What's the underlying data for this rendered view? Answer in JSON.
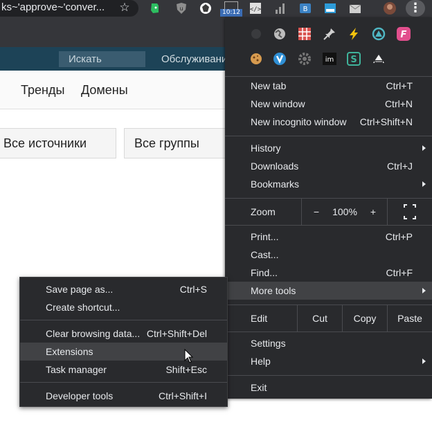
{
  "toolbar": {
    "omnibox_text": "ks~'approve~'conver...",
    "clock_text": "10:12",
    "extension_icons": [
      "evernote-icon",
      "ublock-icon",
      "vpn-icon",
      "clock-icon",
      "dev-icon",
      "chart-icon",
      "translate-icon",
      "screenshot-icon",
      "mail-icon",
      "avatar-icon"
    ],
    "menu_button": "kebab-menu-icon"
  },
  "page": {
    "search_label": "Искать",
    "service_label": "Обслуживани",
    "nav_items": [
      "Тренды",
      "Домены"
    ],
    "filters": [
      "Все источники",
      "Все группы"
    ]
  },
  "menu": {
    "extension_rows": [
      [
        "hidden-icon",
        "globe-icon",
        "grid-icon",
        "pin-icon",
        "bolt-icon",
        "triangle-icon",
        "f-icon"
      ],
      [
        "cookie-icon",
        "v-icon",
        "gear-icon",
        "im-icon",
        "s-icon",
        "camera-icon"
      ]
    ],
    "new_tab": {
      "label": "New tab",
      "shortcut": "Ctrl+T"
    },
    "new_window": {
      "label": "New window",
      "shortcut": "Ctrl+N"
    },
    "new_incognito": {
      "label": "New incognito window",
      "shortcut": "Ctrl+Shift+N"
    },
    "history": {
      "label": "History"
    },
    "downloads": {
      "label": "Downloads",
      "shortcut": "Ctrl+J"
    },
    "bookmarks": {
      "label": "Bookmarks"
    },
    "zoom": {
      "label": "Zoom",
      "minus": "−",
      "value": "100%",
      "plus": "+"
    },
    "print": {
      "label": "Print...",
      "shortcut": "Ctrl+P"
    },
    "cast": {
      "label": "Cast..."
    },
    "find": {
      "label": "Find...",
      "shortcut": "Ctrl+F"
    },
    "more_tools": {
      "label": "More tools"
    },
    "edit": {
      "label": "Edit",
      "cut": "Cut",
      "copy": "Copy",
      "paste": "Paste"
    },
    "settings": {
      "label": "Settings"
    },
    "help": {
      "label": "Help"
    },
    "exit": {
      "label": "Exit"
    }
  },
  "submenu": {
    "save_page": {
      "label": "Save page as...",
      "shortcut": "Ctrl+S"
    },
    "create_shortcut": {
      "label": "Create shortcut..."
    },
    "clear_data": {
      "label": "Clear browsing data...",
      "shortcut": "Ctrl+Shift+Del"
    },
    "extensions": {
      "label": "Extensions"
    },
    "task_manager": {
      "label": "Task manager",
      "shortcut": "Shift+Esc"
    },
    "dev_tools": {
      "label": "Developer tools",
      "shortcut": "Ctrl+Shift+I"
    }
  },
  "colors": {
    "menu_bg": "#292a2d",
    "highlight": "#414245",
    "site_nav": "#1d4357"
  }
}
